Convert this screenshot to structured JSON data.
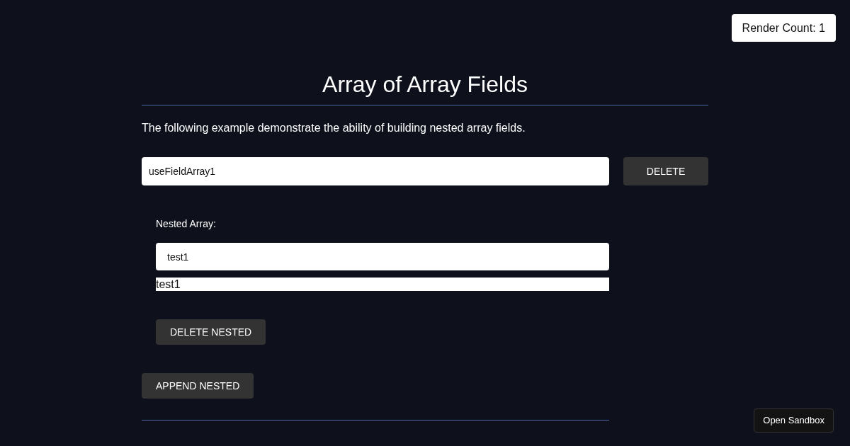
{
  "render_count": "Render Count: 1",
  "title": "Array of Array Fields",
  "description": "The following example demonstrate the ability of building nested array fields.",
  "items": [
    {
      "value": "useFieldArray1",
      "delete_label": "DELETE",
      "nested_label": "Nested Array:",
      "nested": [
        {
          "value": "test1",
          "plain_value": "test1",
          "delete_label": "DELETE NESTED"
        }
      ],
      "append_label": "APPEND NESTED"
    }
  ],
  "sandbox_button": "Open Sandbox"
}
